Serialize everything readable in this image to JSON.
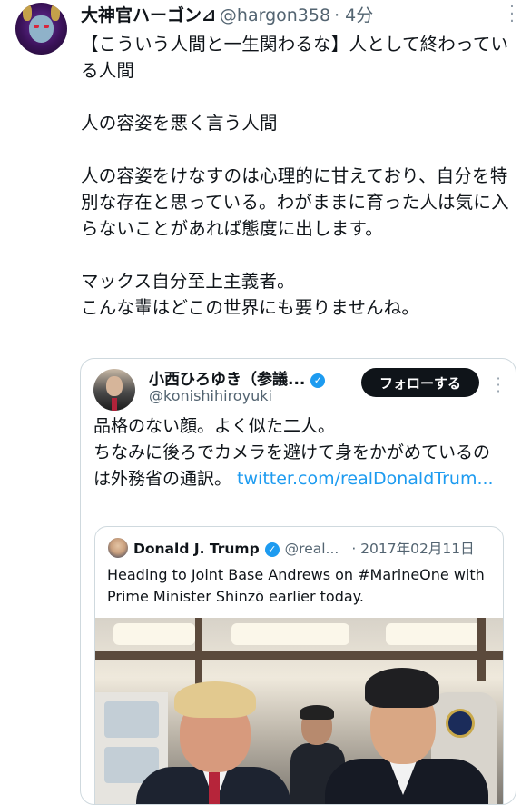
{
  "tweet": {
    "display_name": "大神官ハーゴン⊿",
    "handle": "@hargon358",
    "time": "· 4分",
    "more_icon": "more-vertical-icon",
    "text": "【こういう人間と一生関わるな】人として終わっている人間\n\n人の容姿を悪く言う人間\n\n人の容姿をけなすのは心理的に甘えており、自分を特別な存在と思っている。わがままに育った人は気に入らないことがあれば態度に出します。\n\nマックス自分至上主義者。\nこんな輩はどこの世界にも要りませんね。"
  },
  "quoted": {
    "display_name": "小西ひろゆき（参議...",
    "handle": "@konishihiroyuki",
    "follow_label": "フォローする",
    "text_main": "品格のない顔。よく似た二人。\nちなみに後ろでカメラを避けて身をかがめているのは外務省の通訳。 ",
    "link": "twitter.com/realDonaldTrum..."
  },
  "nested": {
    "display_name": "Donald J. Trump",
    "handle": "@real...",
    "date": "· 2017年02月11日",
    "text": "Heading to Joint Base Andrews on #MarineOne with Prime Minister Shinzō earlier today."
  },
  "colors": {
    "link": "#1d9bf0",
    "verified": "#1d9bf0",
    "follow_bg": "#0f1419",
    "muted": "#536471"
  }
}
